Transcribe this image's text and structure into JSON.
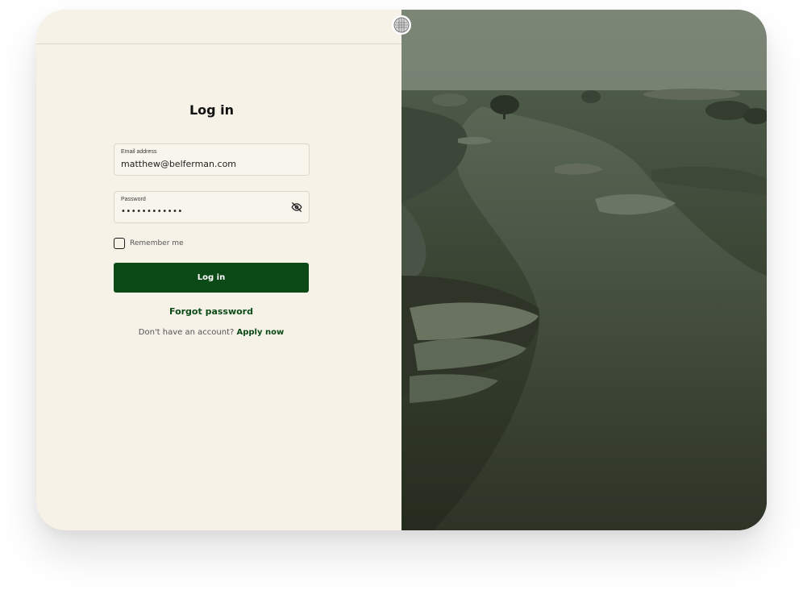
{
  "header": {
    "logo_icon": "golf-ball-icon"
  },
  "login": {
    "title": "Log in",
    "email_label": "Email address",
    "email_value": "matthew@belferman.com",
    "password_label": "Password",
    "password_value": "••••••••••••",
    "password_toggle_icon": "eye-slash-icon",
    "remember_label": "Remember me",
    "remember_checked": false,
    "submit_label": "Log in",
    "forgot_label": "Forgot password",
    "no_account_text": "Don't have an account?",
    "apply_label": "Apply now"
  },
  "hero": {
    "description_icon": "golf-course-photo"
  },
  "colors": {
    "background": "#f6f2e8",
    "brand_green": "#0b4a17",
    "text_dark": "#111111"
  }
}
